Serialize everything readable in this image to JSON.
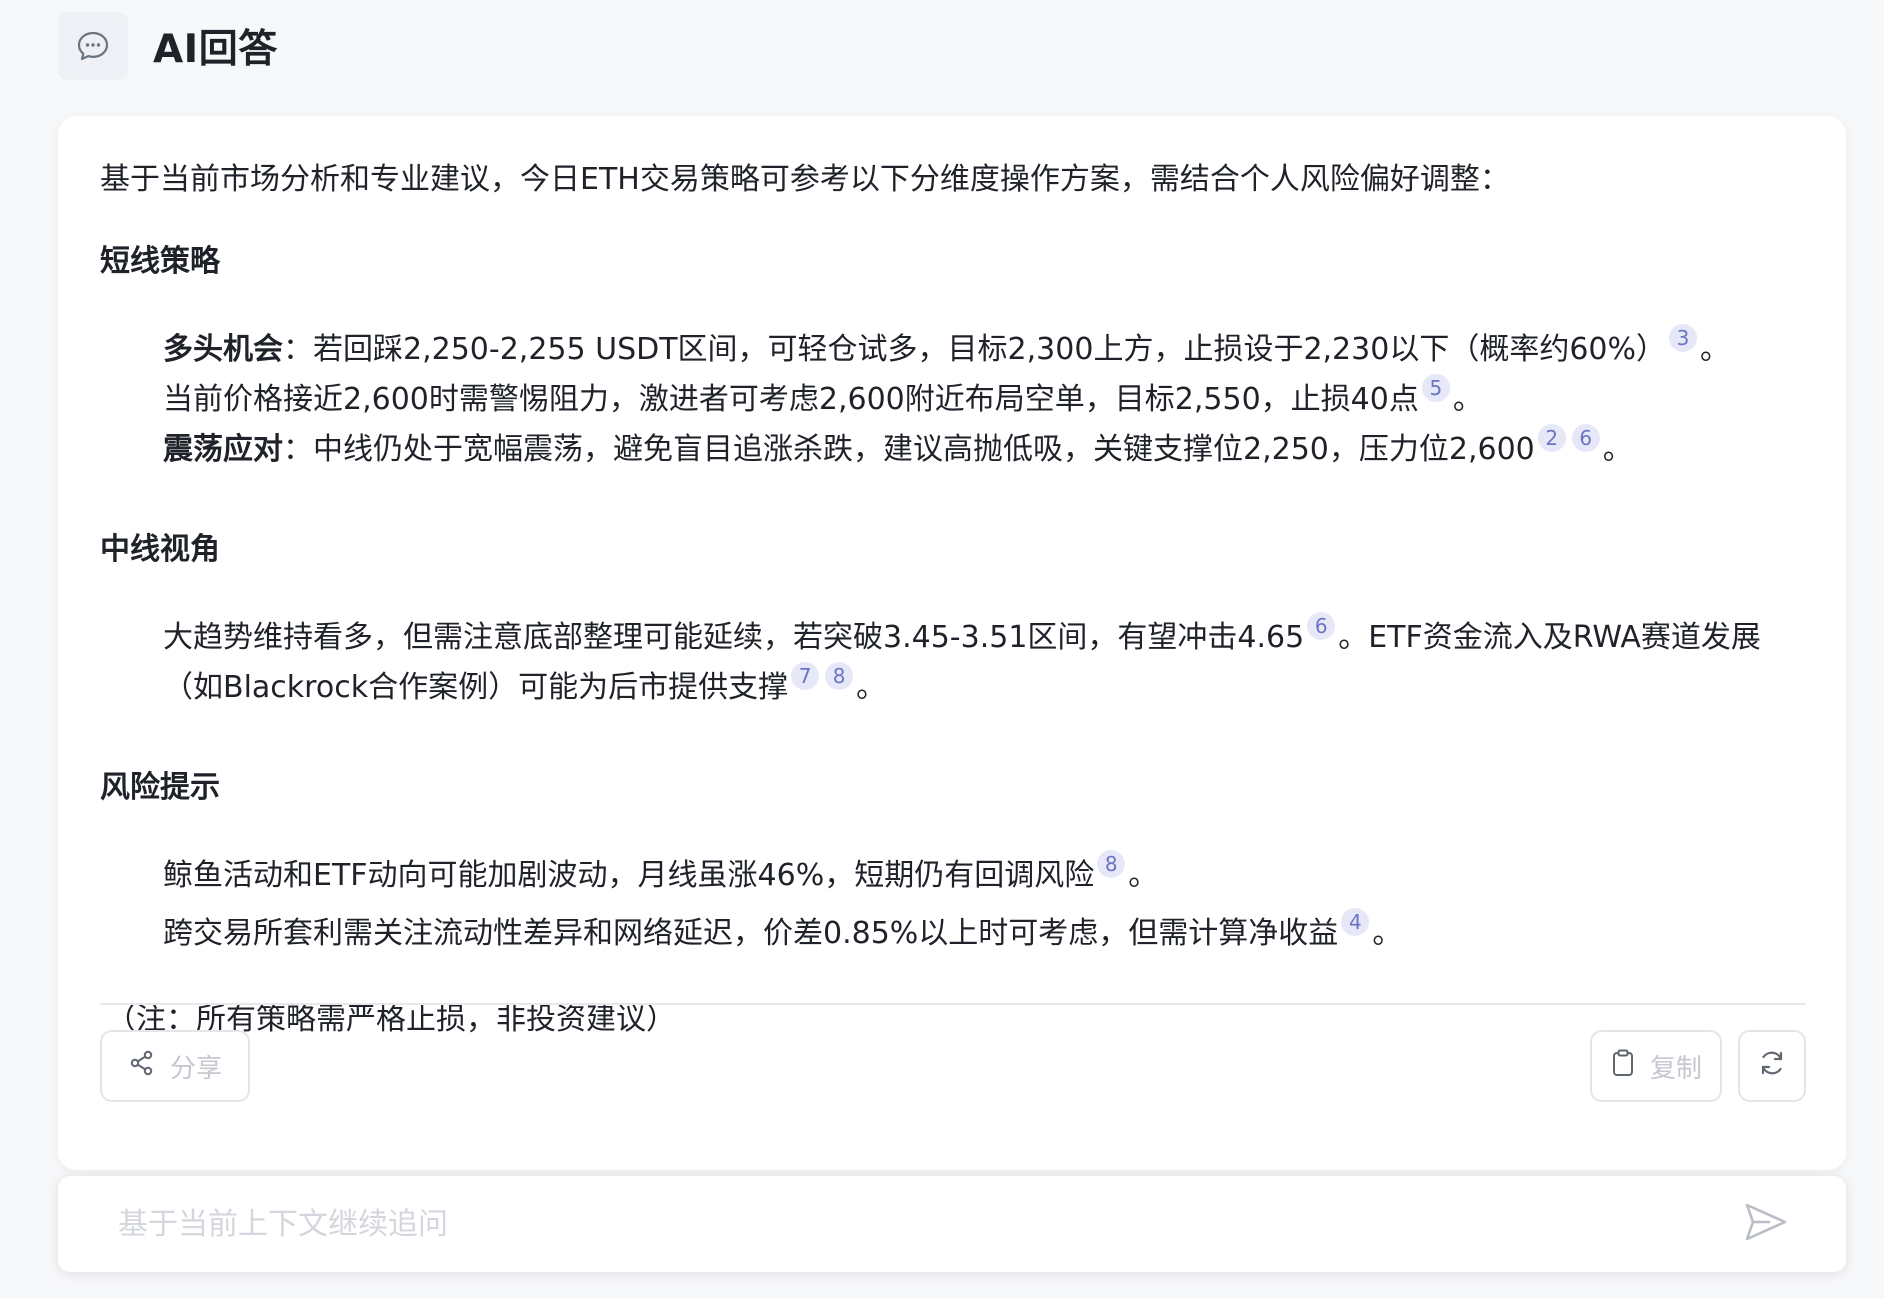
{
  "header": {
    "title": "AI回答",
    "icon": "chat-bubble-icon"
  },
  "answer": {
    "intro": "基于当前市场分析和专业建议，今日ETH交易策略可参考以下分维度操作方案，需结合个人风险偏好调整：",
    "sections": [
      {
        "title": "短线策略",
        "items": [
          {
            "label": "多头机会",
            "text": "：若回踩2,250-2,255 USDT区间，可轻仓试多，目标2,300上方，止损设于2,230以下（概率约60%）",
            "cites": [
              "3"
            ],
            "tail": "。"
          },
          {
            "label": "",
            "text": "当前价格接近2,600时需警惕阻力，激进者可考虑2,600附近布局空单，目标2,550，止损40点",
            "cites": [
              "5"
            ],
            "tail": "。"
          },
          {
            "label": "震荡应对",
            "text": "：中线仍处于宽幅震荡，避免盲目追涨杀跌，建议高抛低吸，关键支撑位2,250，压力位2,600",
            "cites": [
              "2",
              "6"
            ],
            "tail": "。"
          }
        ]
      },
      {
        "title": "中线视角",
        "items": [
          {
            "label": "",
            "text_a": "大趋势维持看多，但需注意底部整理可能延续，若突破3.45-3.51区间，有望冲击4.65",
            "cites_a": [
              "6"
            ],
            "text_b": "。ETF资金流入及RWA赛道发展（如Blackrock合作案例）可能为后市提供支撑",
            "cites_b": [
              "7",
              "8"
            ],
            "tail": "。"
          }
        ]
      },
      {
        "title": "风险提示",
        "items": [
          {
            "label": "",
            "text": "鲸鱼活动和ETF动向可能加剧波动，月线虽涨46%，短期仍有回调风险",
            "cites": [
              "8"
            ],
            "tail": "。"
          },
          {
            "label": "",
            "text": "跨交易所套利需关注流动性差异和网络延迟，价差0.85%以上时可考虑，但需计算净收益",
            "cites": [
              "4"
            ],
            "tail": "。"
          }
        ]
      }
    ],
    "note": "（注：所有策略需严格止损，非投资建议）"
  },
  "actions": {
    "share_label": "分享",
    "copy_label": "复制",
    "share_icon": "share-icon",
    "copy_icon": "clipboard-icon",
    "refresh_icon": "refresh-icon"
  },
  "followup": {
    "placeholder": "基于当前上下文继续追问",
    "send_icon": "send-icon"
  },
  "colors": {
    "background": "#f7f8fa",
    "card": "#ffffff",
    "text": "#1f2329",
    "cite_bg": "#e6e8f8",
    "cite_text": "#6b73c4",
    "muted": "#c5c8cf"
  }
}
